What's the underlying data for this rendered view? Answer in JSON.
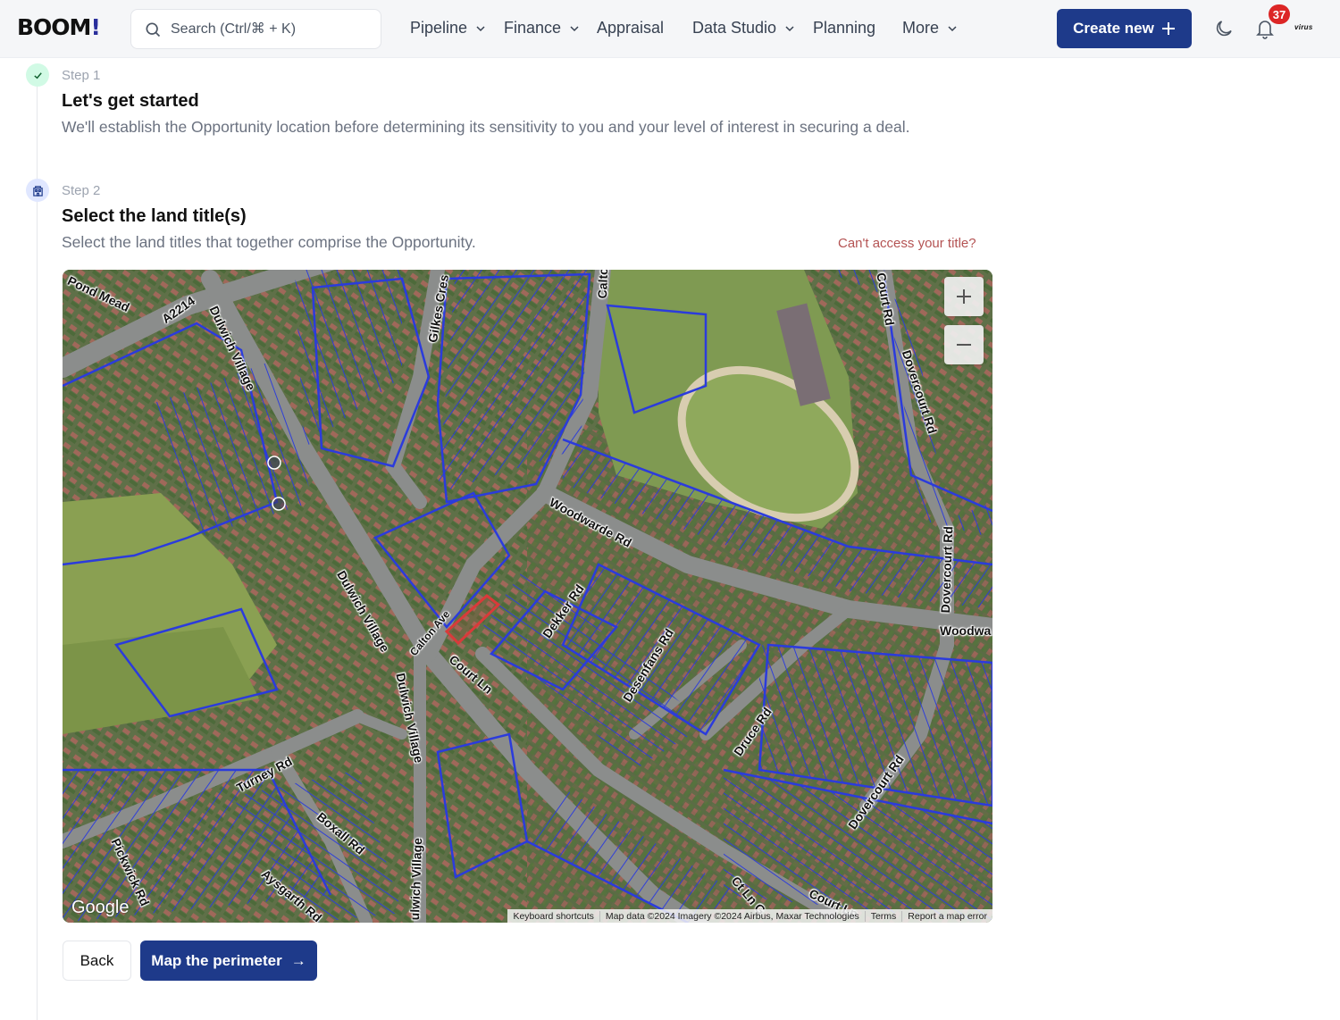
{
  "header": {
    "logo": "BOOM",
    "logo_mark": "!",
    "search_placeholder": "Search (Ctrl/⌘ + K)",
    "nav": [
      {
        "label": "Pipeline",
        "has_dropdown": true
      },
      {
        "label": "Finance",
        "has_dropdown": true
      },
      {
        "label": "Appraisal",
        "has_dropdown": false
      },
      {
        "label": "Data Studio",
        "has_dropdown": true
      },
      {
        "label": "Planning",
        "has_dropdown": false
      },
      {
        "label": "More",
        "has_dropdown": true
      }
    ],
    "create_button": "Create new",
    "notification_count": "37",
    "org_name": "virus",
    "icons": [
      "search-icon",
      "chevron-down-icon",
      "plus-icon",
      "moon-icon",
      "bell-icon"
    ]
  },
  "steps": [
    {
      "label": "Step 1",
      "title": "Let's get started",
      "description": "We'll establish the Opportunity location before determining its sensitivity to you and your level of interest in securing a deal.",
      "status": "complete",
      "icon": "check-icon"
    },
    {
      "label": "Step 2",
      "title": "Select the land title(s)",
      "description": "Select the land titles that together comprise the Opportunity.",
      "status": "active",
      "icon": "building-icon",
      "help_link": "Can't access your title?"
    }
  ],
  "map": {
    "type": "satellite",
    "zoom_in_label": "+",
    "zoom_out_label": "−",
    "provider_logo": "Google",
    "boundary_color": "#2b3bdc",
    "selected_parcel_color": "#d93a3a",
    "attribution": [
      "Keyboard shortcuts",
      "Map data ©2024 Imagery ©2024 Airbus, Maxar Technologies",
      "Terms",
      "Report a map error"
    ],
    "road_labels": [
      "Pond Mead",
      "A2214",
      "Dulwich Village",
      "Gilkes Cres",
      "Calton Ave",
      "Court Rd",
      "Dovercourt Rd",
      "Woodwarde Rd",
      "Dulwich Village",
      "Calton Ave",
      "Court Ln",
      "Dekker Rd",
      "Desenfans Rd",
      "Druce Rd",
      "Dovercourt Rd",
      "Woodwa",
      "Dulwich Village",
      "Turney Rd",
      "Boxall Rd",
      "Dovercourt Rd",
      "Pickwick Rd",
      "Aysgarth Rd",
      "ulwich Village",
      "Ct Ln G",
      "Court Ln"
    ]
  },
  "actions": {
    "back": "Back",
    "next": "Map the perimeter",
    "next_icon": "→"
  }
}
